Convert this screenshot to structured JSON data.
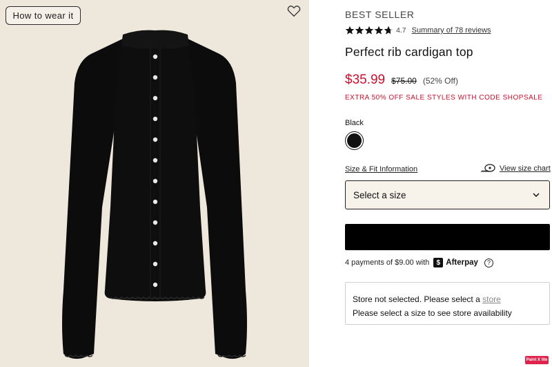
{
  "image_panel": {
    "how_to_wear_label": "How to wear it",
    "garment_color": "#0c0c0c",
    "background_color": "#eee7db"
  },
  "product": {
    "badge": "BEST SELLER",
    "rating_value": "4.7",
    "rating_stars": 4.7,
    "reviews_link": "Summary of 78 reviews",
    "title": "Perfect rib cardigan top",
    "sale_price": "$35.99",
    "original_price": "$75.00",
    "percent_off": "(52% Off)",
    "promo": "EXTRA 50% OFF SALE STYLES WITH CODE SHOPSALE",
    "sale_color": "#c8102e"
  },
  "color": {
    "selected_label": "Black",
    "swatch_hex": "#111111"
  },
  "size": {
    "fit_info_link": "Size & Fit Information",
    "chart_link": "View size chart",
    "select_placeholder": "Select a size"
  },
  "afterpay": {
    "text": "4 payments of $9.00 with",
    "brand": "Afterpay",
    "logo_glyph": "$",
    "info_glyph": "?"
  },
  "store": {
    "line1_prefix": "Store not selected. Please select a",
    "line1_link": "store",
    "line2": "Please select a size to see store availability"
  },
  "extension_tag": "Paint X lite"
}
